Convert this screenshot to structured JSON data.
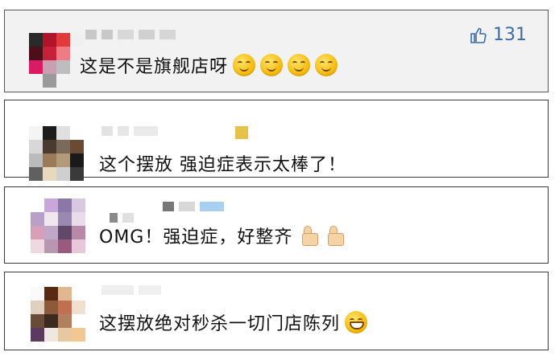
{
  "comments": [
    {
      "text": "这是不是旗舰店呀",
      "emojis": [
        "thinking-face-icon",
        "thinking-face-icon",
        "thinking-face-icon",
        "thinking-face-icon"
      ],
      "likes": "131"
    },
    {
      "text": "这个摆放 强迫症表示太棒了！"
    },
    {
      "text": "OMG！强迫症，好整齐",
      "emojis": [
        "thumbs-up-icon",
        "thumbs-up-icon"
      ]
    },
    {
      "text": "这摆放绝对秒杀一切门店陈列",
      "emojis": [
        "grinning-face-icon"
      ]
    }
  ],
  "colors": {
    "like": "#3a6ba8",
    "card_border": "#3a3a3a"
  }
}
